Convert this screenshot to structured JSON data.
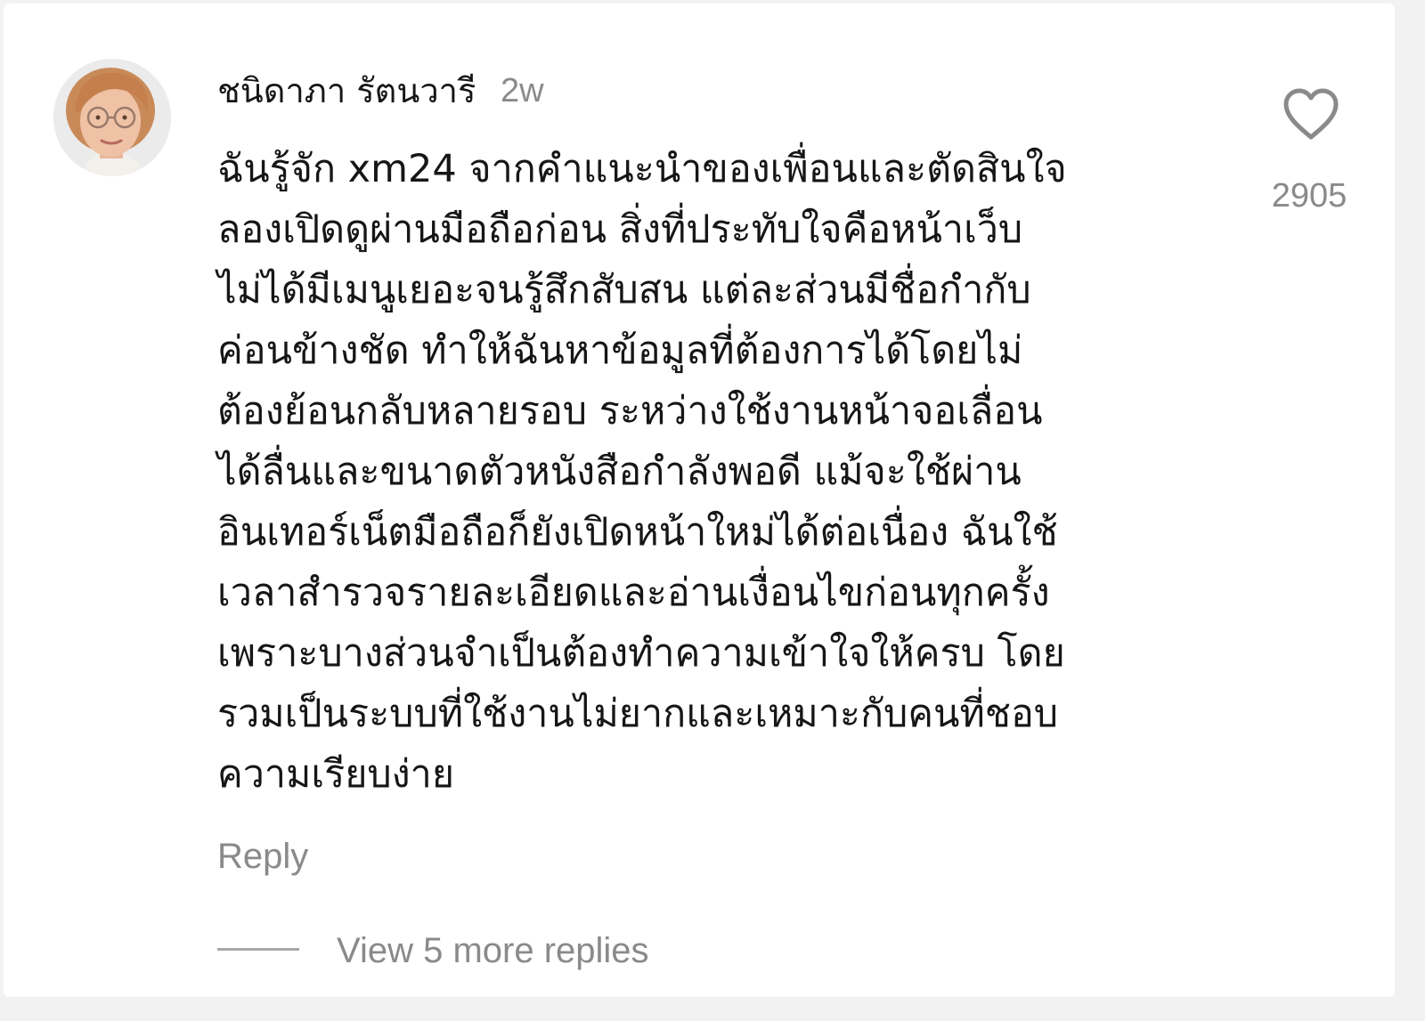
{
  "comment": {
    "author": "ชนิดาภา รัตนวารี",
    "time": "2w",
    "text_lines": [
      "ฉันรู้จัก xm24 จากคำแนะนำของเพื่อนและตัดสินใจ",
      "ลองเปิดดูผ่านมือถือก่อน สิ่งที่ประทับใจคือหน้าเว็บ",
      "ไม่ได้มีเมนูเยอะจนรู้สึกสับสน แต่ละส่วนมีชื่อกำกับ",
      "ค่อนข้างชัด ทำให้ฉันหาข้อมูลที่ต้องการได้โดยไม่",
      "ต้องย้อนกลับหลายรอบ ระหว่างใช้งานหน้าจอเลื่อน",
      "ได้ลื่นและขนาดตัวหนังสือกำลังพอดี แม้จะใช้ผ่าน",
      "อินเทอร์เน็ตมือถือก็ยังเปิดหน้าใหม่ได้ต่อเนื่อง ฉันใช้",
      "เวลาสำรวจรายละเอียดและอ่านเงื่อนไขก่อนทุกครั้ง",
      "เพราะบางส่วนจำเป็นต้องทำความเข้าใจให้ครบ โดย",
      "รวมเป็นระบบที่ใช้งานไม่ยากและเหมาะกับคนที่ชอบ",
      "ความเรียบง่าย"
    ],
    "like_count": "2905",
    "like_icon": "heart-outline-icon",
    "reply_label": "Reply",
    "view_more_label": "View 5 more replies"
  },
  "colors": {
    "text_primary": "#161616",
    "text_secondary": "#8a8a8a",
    "heart_stroke": "#8a8a8a",
    "background": "#ffffff"
  }
}
